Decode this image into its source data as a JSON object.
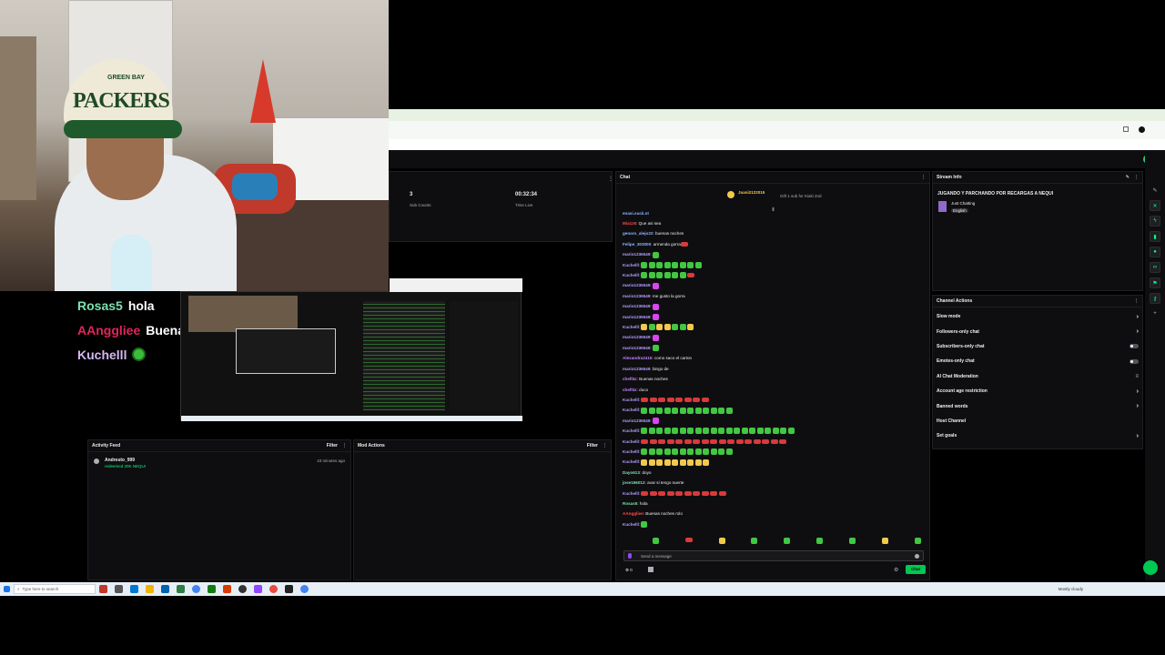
{
  "overlay_chat": [
    {
      "user": "Rosas5",
      "message": "hola",
      "color": "#7ee0b0",
      "emote": false
    },
    {
      "user": "AAnggliee",
      "message": "Buenas noches rolo",
      "color": "#e0245e",
      "emote": false
    },
    {
      "user": "Kuchelll",
      "message": "",
      "color": "#d5b7f2",
      "emote": true
    }
  ],
  "stats": {
    "subs": "3",
    "subs_label": "Sub Counts",
    "time": "00:32:34",
    "time_label": "Time Live"
  },
  "activity_feed": {
    "title": "Activity Feed",
    "filter": "Filter",
    "item": {
      "user": "Andresto_999",
      "detail": "redeemed 20K NEQUI",
      "time": "43 minutes ago"
    }
  },
  "mod_actions": {
    "title": "Mod Actions",
    "filter": "Filter"
  },
  "chat": {
    "title": "Chat",
    "pinned_user": "Juani2122015",
    "pinned_sub": "Gift 1 sub for Kiaki 2nd",
    "first_user": "enasi.suck.st",
    "messages": [
      {
        "user": "Mia1z6",
        "color": "#ff4a4a",
        "text": "Que asi sea",
        "emotes": ""
      },
      {
        "user": "genaro_alejo22",
        "color": "#8fb4ff",
        "text": "buenas noches",
        "emotes": ""
      },
      {
        "user": "Felipe_303000",
        "color": "#8fb4ff",
        "text": "armenda gorra",
        "emotes": "r"
      },
      {
        "user": "mario1236549",
        "color": "#b39cff",
        "text": "",
        "emotes": "g"
      },
      {
        "user": "Kuchelll",
        "color": "#b39cff",
        "text": "",
        "emotes": "gggggggg"
      },
      {
        "user": "Kuchelll",
        "color": "#b39cff",
        "text": "",
        "emotes": "ggggggr"
      },
      {
        "user": "mario1236549",
        "color": "#b39cff",
        "text": "",
        "emotes": "p"
      },
      {
        "user": "mario1236549",
        "color": "#b39cff",
        "text": "me gusto la gorra",
        "emotes": ""
      },
      {
        "user": "mario1236549",
        "color": "#b39cff",
        "text": "",
        "emotes": "p"
      },
      {
        "user": "mario1236549",
        "color": "#b39cff",
        "text": "",
        "emotes": "p"
      },
      {
        "user": "Kuchelll",
        "color": "#b39cff",
        "text": "",
        "emotes": "ygyyggy"
      },
      {
        "user": "mario1236549",
        "color": "#b39cff",
        "text": "",
        "emotes": "p"
      },
      {
        "user": "mario1236549",
        "color": "#b39cff",
        "text": "",
        "emotes": "g"
      },
      {
        "user": "Alexandra2415",
        "color": "#c084fc",
        "text": "como saco el carton",
        "emotes": ""
      },
      {
        "user": "mario1236549",
        "color": "#b39cff",
        "text": "bingo de",
        "emotes": ""
      },
      {
        "user": "chelf4z",
        "color": "#c084fc",
        "text": "Buenas noches",
        "emotes": ""
      },
      {
        "user": "chelf4z",
        "color": "#c084fc",
        "text": "duco",
        "emotes": ""
      },
      {
        "user": "Kuchelll",
        "color": "#b39cff",
        "text": "",
        "emotes": "rrrrrrrr"
      },
      {
        "user": "Kuchelll",
        "color": "#b39cff",
        "text": "",
        "emotes": "gggggggggggg"
      },
      {
        "user": "mario1236549",
        "color": "#b39cff",
        "text": "",
        "emotes": "p"
      },
      {
        "user": "Kuchelll",
        "color": "#b39cff",
        "text": "",
        "emotes": "gggggggggggggggggggg"
      },
      {
        "user": "Kuchelll",
        "color": "#b39cff",
        "text": "",
        "emotes": "rrrrrrrrrrrrrrrrr"
      },
      {
        "user": "Kuchelll",
        "color": "#b39cff",
        "text": "",
        "emotes": "gggggggggggg"
      },
      {
        "user": "Kuchelll",
        "color": "#b39cff",
        "text": "",
        "emotes": "yyyyyyyyy"
      },
      {
        "user": "Dayo613",
        "color": "#7ee0b0",
        "text": "doyo",
        "emotes": ""
      },
      {
        "user": "jose166012",
        "color": "#7ee0b0",
        "text": "avar si tengo suerte",
        "emotes": ""
      },
      {
        "user": "Kuchelll",
        "color": "#b39cff",
        "text": "",
        "emotes": "rrrrrrrrrr"
      },
      {
        "user": "Rosas5",
        "color": "#7ee0b0",
        "text": "hola",
        "emotes": ""
      },
      {
        "user": "AAnggliee",
        "color": "#ff4a4a",
        "text": "Buenas noches rolo",
        "emotes": ""
      },
      {
        "user": "Kuchelll",
        "color": "#b39cff",
        "text": "",
        "emotes": "g"
      }
    ],
    "input_placeholder": "Send a message",
    "points": "0",
    "send_label": "Chat"
  },
  "stream_info": {
    "title": "Stream Info",
    "stream_title": "JUGANDO Y PARCHANDO POR RECARGAS A NEQUI",
    "category": "Just Chatting",
    "language": "English"
  },
  "channel_actions": {
    "title": "Channel Actions",
    "items": [
      {
        "label": "Slow mode",
        "control": "chevron"
      },
      {
        "label": "Followers-only chat",
        "control": "chevron"
      },
      {
        "label": "Subscribers-only chat",
        "control": "toggle"
      },
      {
        "label": "Emotes-only chat",
        "control": "toggle"
      },
      {
        "label": "AI Chat Moderation",
        "control": "settings"
      },
      {
        "label": "Account age restriction",
        "control": "chevron"
      },
      {
        "label": "Banned words",
        "control": "chevron"
      },
      {
        "label": "Host Channel",
        "control": "none"
      },
      {
        "label": "Set goals",
        "control": "chevron"
      }
    ]
  },
  "taskbar": {
    "search_placeholder": "Type here to search",
    "weather": "Mostly cloudy"
  },
  "colors": {
    "accent": "#00ff7f",
    "panel_bg": "#0e0e10",
    "twitch_purple": "#9147ff"
  }
}
